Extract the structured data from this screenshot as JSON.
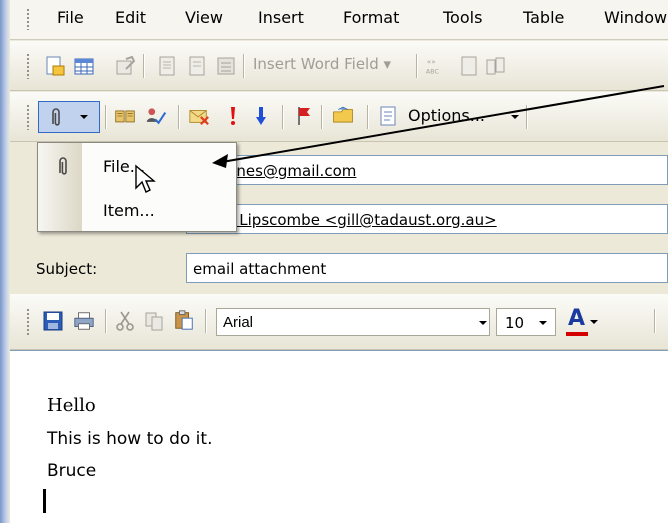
{
  "menubar": {
    "items": [
      {
        "label": "File"
      },
      {
        "label": "Edit"
      },
      {
        "label": "View"
      },
      {
        "label": "Insert"
      },
      {
        "label": "Format"
      },
      {
        "label": "Tools"
      },
      {
        "label": "Table"
      },
      {
        "label": "Window"
      }
    ]
  },
  "toolbar1": {
    "insert_word_field": "Insert Word Field ▾"
  },
  "toolbar2": {
    "options_label": "Options..."
  },
  "popup": {
    "file_label": "File...",
    "item_label": "Item..."
  },
  "header": {
    "to_value": "jones@gmail.com",
    "cc_value": "n Lipscombe <gill@tadaust.org.au>",
    "subject_label": "Subject:",
    "subject_value": "email attachment"
  },
  "format_toolbar": {
    "font_name": "Arial",
    "font_size": "10",
    "font_color_glyph": "A",
    "font_color": "#d40000"
  },
  "message_body": {
    "lines": [
      "Hello",
      "This is how to do it.",
      "Bruce"
    ]
  }
}
